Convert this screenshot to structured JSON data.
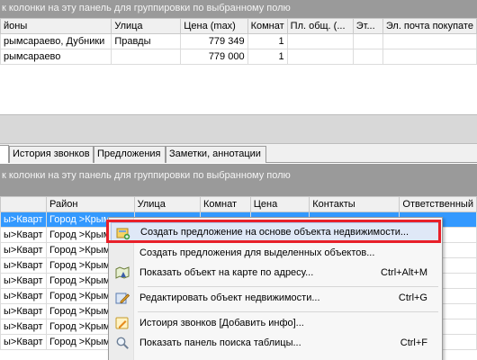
{
  "top_group_panel": "к колонки на эту панель для группировки по выбранному полю",
  "top_grid": {
    "columns": [
      "йоны",
      "Улица",
      "Цена (max)",
      "Комнат",
      "Пл. общ. (...",
      "Эт...",
      "Эл. почта покупате"
    ],
    "rows": [
      [
        "рымсараево, Дубники",
        "Правды",
        "779 349",
        "1",
        "",
        "",
        ""
      ],
      [
        "рымсараево",
        "",
        "779 000",
        "1",
        "",
        "",
        ""
      ]
    ]
  },
  "tabs": [
    "",
    "История звонков",
    "Предложения",
    "Заметки, аннотации"
  ],
  "bottom_group_panel": "к колонки на эту панель для группировки по выбранному полю",
  "bottom_grid": {
    "columns": [
      "",
      "Район",
      "Улица",
      "Комнат",
      "Цена",
      "Контакты",
      "Ответственный"
    ],
    "rows": [
      [
        "ы>Кварт",
        "Город >Крым",
        "",
        "",
        "",
        "",
        ""
      ],
      [
        "ы>Кварт",
        "Город >Крым",
        "",
        "",
        "",
        "",
        ""
      ],
      [
        "ы>Кварт",
        "Город >Крым",
        "",
        "",
        "",
        "",
        ""
      ],
      [
        "ы>Кварт",
        "Город >Крым",
        "",
        "",
        "",
        "",
        ""
      ],
      [
        "ы>Кварт",
        "Город >Крым",
        "",
        "",
        "",
        "",
        ""
      ],
      [
        "ы>Кварт",
        "Город >Крым",
        "",
        "",
        "",
        "",
        ""
      ],
      [
        "ы>Кварт",
        "Город >Крым",
        "",
        "",
        "",
        "",
        ""
      ],
      [
        "ы>Кварт",
        "Город >Крым",
        "",
        "",
        "",
        "",
        ""
      ],
      [
        "ы>Кварт",
        "Город >Крым",
        "",
        "",
        "",
        "",
        ""
      ]
    ]
  },
  "context_menu": {
    "items": [
      {
        "label": "Создать предложение на основе объекта недвижимости...",
        "shortcut": "",
        "icon": "create-offer-icon"
      },
      {
        "label": "Создать предложения для выделенных объектов...",
        "shortcut": "",
        "icon": ""
      },
      {
        "label": "Показать объект на карте по адресу...",
        "shortcut": "Ctrl+Alt+M",
        "icon": "map-icon"
      },
      {
        "label": "Редактировать объект недвижимости...",
        "shortcut": "Ctrl+G",
        "icon": "edit-icon"
      },
      {
        "label": "Истоиря звонков [Добавить инфо]...",
        "shortcut": "",
        "icon": "pencil-icon"
      },
      {
        "label": "Показать панель поиска таблицы...",
        "shortcut": "Ctrl+F",
        "icon": "magnifier-icon"
      }
    ]
  }
}
